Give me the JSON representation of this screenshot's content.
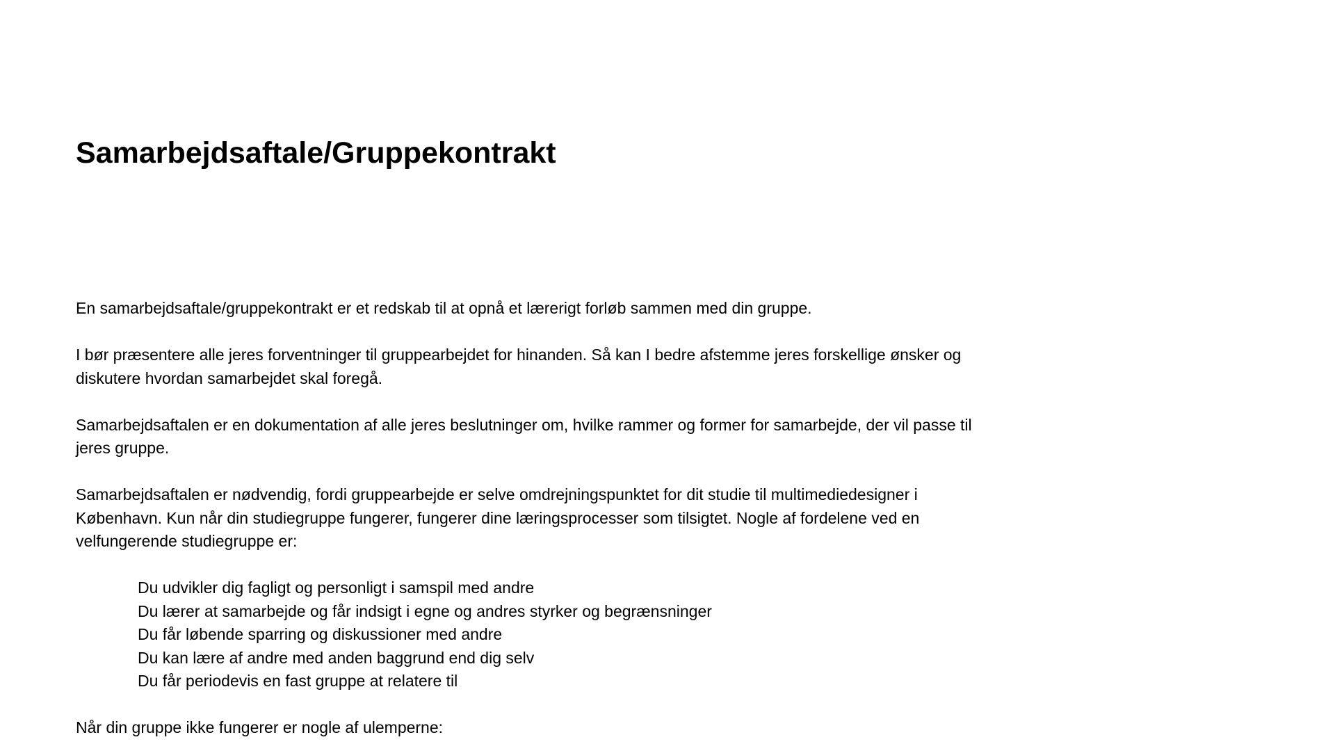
{
  "document": {
    "title": "Samarbejdsaftale/Gruppekontrakt",
    "paragraphs": [
      "En samarbejdsaftale/gruppekontrakt er et redskab til at opnå et lærerigt forløb sammen med din gruppe.",
      "I bør præsentere alle jeres forventninger til gruppearbejdet for hinanden. Så kan I bedre afstemme jeres forskellige ønsker og diskutere hvordan samarbejdet skal foregå.",
      "Samarbejdsaftalen er en dokumentation af alle jeres beslutninger om, hvilke rammer og former for samarbejde, der vil passe til jeres gruppe.",
      "Samarbejdsaftalen er nødvendig, fordi gruppearbejde er selve omdrejningspunktet for dit studie til multimediedesigner i København. Kun når din studiegruppe fungerer, fungerer dine læringsprocesser som tilsigtet. Nogle af fordelene ved en velfungerende studiegruppe er:"
    ],
    "advantages": [
      "Du udvikler dig fagligt og personligt i samspil med andre",
      "Du lærer at samarbejde og får indsigt i egne og andres styrker og begrænsninger",
      "Du får løbende sparring og diskussioner med andre",
      "Du kan lære af andre med anden baggrund end dig selv",
      "Du får periodevis en fast gruppe at relatere til"
    ],
    "closing_paragraph": "Når din gruppe ikke fungerer er nogle af ulemperne:"
  }
}
